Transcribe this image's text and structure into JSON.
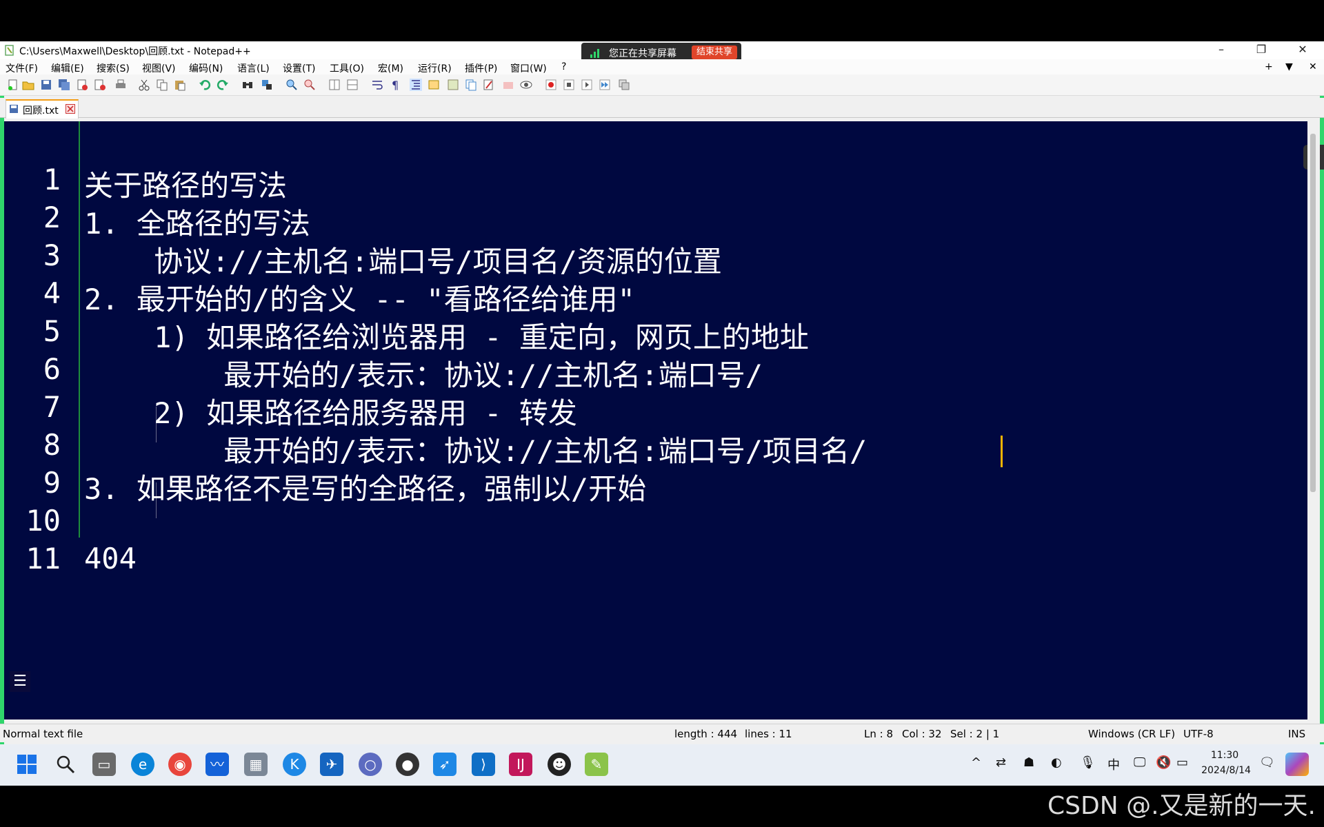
{
  "window": {
    "title": "C:\\Users\\Maxwell\\Desktop\\回顾.txt - Notepad++",
    "controls": {
      "minimize": "–",
      "restore": "❐",
      "close": "✕"
    }
  },
  "share_banner": {
    "text": "您正在共享屏幕",
    "end_button": "结束共享"
  },
  "menu": {
    "items": [
      "文件(F)",
      "编辑(E)",
      "搜索(S)",
      "视图(V)",
      "编码(N)",
      "语言(L)",
      "设置(T)",
      "工具(O)",
      "宏(M)",
      "运行(R)",
      "插件(P)",
      "窗口(W)",
      "?"
    ],
    "right": {
      "plus": "+",
      "down": "▼",
      "close": "✕"
    }
  },
  "tab": {
    "label": "回顾.txt"
  },
  "editor": {
    "lines": [
      {
        "num": "1",
        "text": "关于路径的写法"
      },
      {
        "num": "2",
        "text": "1. 全路径的写法"
      },
      {
        "num": "3",
        "text": "    协议://主机名:端口号/项目名/资源的位置"
      },
      {
        "num": "4",
        "text": "2. 最开始的/的含义 -- \"看路径给谁用\""
      },
      {
        "num": "5",
        "text": "    1) 如果路径给浏览器用 - 重定向，网页上的地址"
      },
      {
        "num": "6",
        "text": "        最开始的/表示：协议://主机名:端口号/"
      },
      {
        "num": "7",
        "text": "    2) 如果路径给服务器用 - 转发"
      },
      {
        "num": "8",
        "text": "        最开始的/表示：协议://主机名:端口号/项目名/"
      },
      {
        "num": "9",
        "text": "3. 如果路径不是写的全路径，强制以/开始"
      },
      {
        "num": "10",
        "text": ""
      },
      {
        "num": "11",
        "text": "404"
      }
    ]
  },
  "status": {
    "file_type": "Normal text file",
    "length": "length : 444",
    "lines": "lines : 11",
    "ln": "Ln : 8",
    "col": "Col : 32",
    "sel": "Sel : 2 | 1",
    "eol": "Windows (CR LF)",
    "encoding": "UTF-8",
    "mode": "INS"
  },
  "taskbar": {
    "tray": {
      "caret": "^",
      "ime": "中"
    },
    "time": "11:30",
    "date": "2024/8/14"
  },
  "watermark": "CSDN @.又是新的一天.",
  "colors": {
    "editor_bg": "#000840",
    "accent_green": "#2fd66b",
    "share_end": "#e0452a"
  }
}
